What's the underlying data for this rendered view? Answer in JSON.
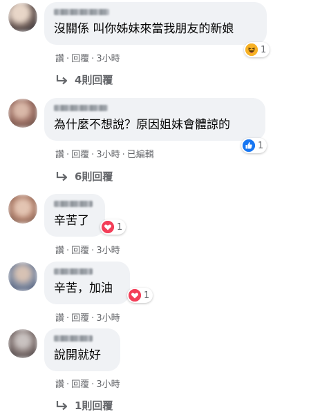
{
  "comments": [
    {
      "text": "沒關係 叫你姊妹來當我朋友的新娘",
      "reaction": {
        "icon": "haha-emoji-icon",
        "count": "1",
        "color": "#f7b125"
      },
      "actions": [
        "讚",
        "回覆",
        "3小時"
      ],
      "replies": "4則回覆"
    },
    {
      "text": "為什麼不想說？原因姐妹會體諒的",
      "reaction": {
        "icon": "like-thumb-icon",
        "count": "1",
        "color": "#1877f2"
      },
      "actions": [
        "讚",
        "回覆",
        "3小時",
        "已編輯"
      ],
      "replies": "6則回覆"
    },
    {
      "text": "辛苦了",
      "reaction": {
        "icon": "love-heart-icon",
        "count": "1",
        "color": "#f33e58"
      },
      "actions": [
        "讚",
        "回覆",
        "3小時"
      ]
    },
    {
      "text": "辛苦，加油",
      "reaction": {
        "icon": "love-heart-icon",
        "count": "1",
        "color": "#f33e58"
      },
      "actions": [
        "讚",
        "回覆",
        "3小時"
      ]
    },
    {
      "text": "說開就好",
      "actions": [
        "讚",
        "回覆",
        "3小時"
      ],
      "replies": "1則回覆"
    }
  ],
  "separator": "·"
}
